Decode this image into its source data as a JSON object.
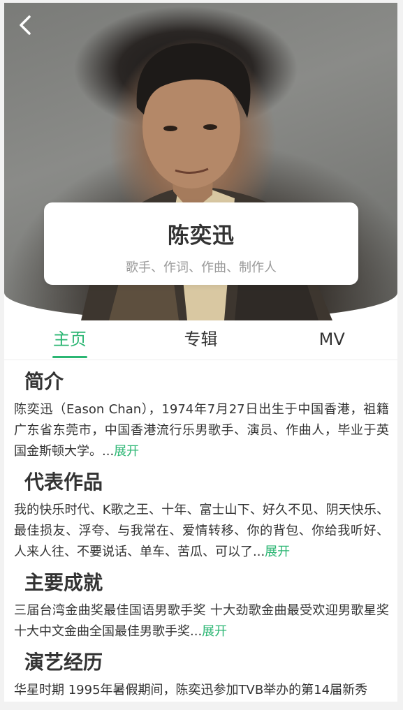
{
  "header": {
    "back_icon": "chevron-left-icon"
  },
  "artist": {
    "name": "陈奕迅",
    "roles": "歌手、作词、作曲、制作人"
  },
  "tabs": [
    {
      "label": "主页",
      "active": true
    },
    {
      "label": "专辑",
      "active": false
    },
    {
      "label": "MV",
      "active": false
    }
  ],
  "accent_color": "#2bb673",
  "sections": [
    {
      "title": "简介",
      "body": "陈奕迅（Eason Chan），1974年7月27日出生于中国香港，祖籍广东省东莞市，中国香港流行乐男歌手、演员、作曲人，毕业于英国金斯顿大学。...",
      "expand_label": "展开"
    },
    {
      "title": "代表作品",
      "body": "我的快乐时代、K歌之王、十年、富士山下、好久不见、阴天快乐、最佳损友、浮夸、与我常在、爱情转移、你的背包、你给我听好、人来人往、不要说话、单车、苦瓜、可以了...",
      "expand_label": "展开"
    },
    {
      "title": "主要成就",
      "body": "三届台湾金曲奖最佳国语男歌手奖 十大劲歌金曲最受欢迎男歌星奖 十大中文金曲全国最佳男歌手奖...",
      "expand_label": "展开"
    },
    {
      "title": "演艺经历",
      "body": "华星时期 1995年暑假期间，陈奕迅参加TVB举办的第14届新秀",
      "expand_label": ""
    }
  ]
}
